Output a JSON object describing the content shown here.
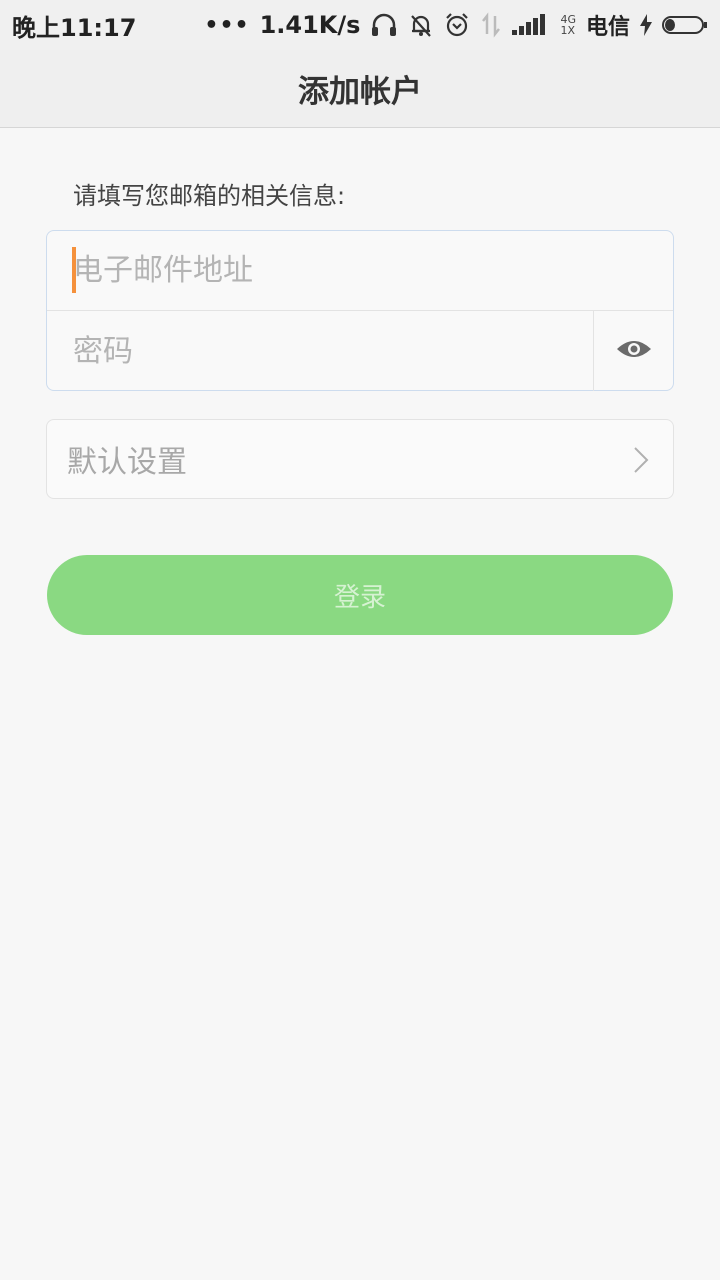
{
  "status_bar": {
    "time": "晚上11:17",
    "dots": "•••",
    "speed": "1.41K/s",
    "network_top": "4G",
    "network_bottom": "1X",
    "carrier": "电信"
  },
  "header": {
    "title": "添加帐户"
  },
  "form": {
    "instruction": "请填写您邮箱的相关信息:",
    "email_placeholder": "电子邮件地址",
    "password_placeholder": "密码",
    "settings_label": "默认设置",
    "login_label": "登录"
  },
  "colors": {
    "accent_caret": "#f5913c",
    "login_button": "#8ad982",
    "login_text": "#d6f2d2"
  },
  "icons": [
    "headphones-icon",
    "mute-bell-icon",
    "alarm-icon",
    "data-transfer-icon",
    "signal-icon",
    "charging-icon",
    "battery-icon",
    "eye-icon",
    "chevron-right-icon"
  ]
}
